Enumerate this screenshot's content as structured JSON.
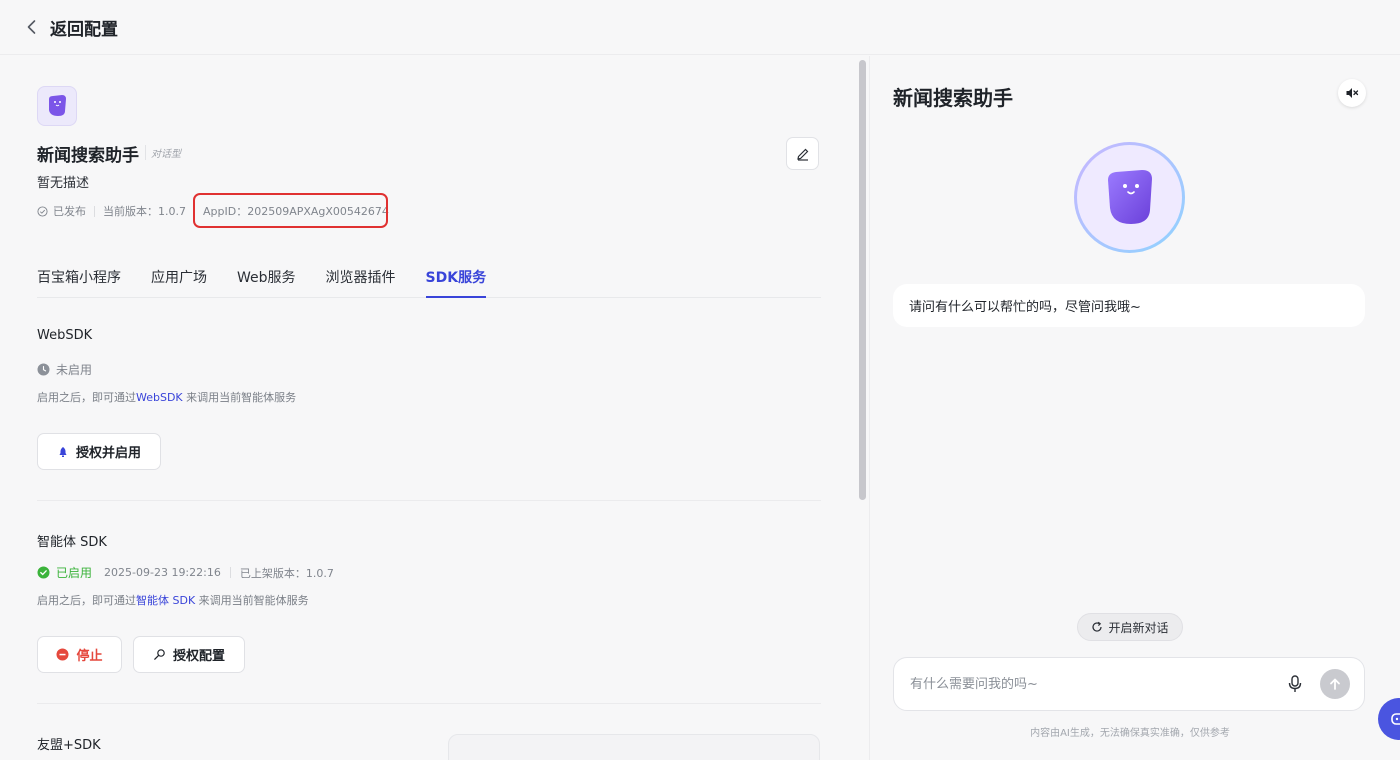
{
  "topbar": {
    "back_label": "返回配置"
  },
  "app": {
    "name": "新闻搜索助手",
    "type": "对话型",
    "description": "暂无描述",
    "status": "已发布",
    "version": "当前版本：1.0.7",
    "app_id": "AppID：202509APXAgX00542674"
  },
  "tabs": [
    {
      "label": "百宝箱小程序"
    },
    {
      "label": "应用广场"
    },
    {
      "label": "Web服务"
    },
    {
      "label": "浏览器插件"
    },
    {
      "label": "SDK服务"
    }
  ],
  "websdk": {
    "title": "WebSDK",
    "status": "未启用",
    "hint_prefix": "启用之后，即可通过",
    "hint_link": "WebSDK",
    "hint_suffix": " 来调用当前智能体服务",
    "button": "授权并启用"
  },
  "agent_sdk": {
    "title": "智能体 SDK",
    "status": "已启用",
    "date": "2025-09-23 19:22:16",
    "version": "已上架版本：1.0.7",
    "hint_prefix": "启用之后，即可通过",
    "hint_link": "智能体 SDK",
    "hint_suffix": " 来调用当前智能体服务",
    "stop_button": "停止",
    "auth_button": "授权配置"
  },
  "umeng": {
    "title": "友盟+SDK"
  },
  "chat": {
    "title": "新闻搜索助手",
    "greeting": "请问有什么可以帮忙的吗，尽管问我哦~",
    "new_chat": "开启新对话",
    "input_placeholder": "有什么需要问我的吗~",
    "disclaimer": "内容由AI生成，无法确保真实准确，仅供参考"
  },
  "colors": {
    "accent": "#3944d9",
    "success": "#3bb33b",
    "danger": "#e5483d",
    "highlight": "#e03131"
  }
}
